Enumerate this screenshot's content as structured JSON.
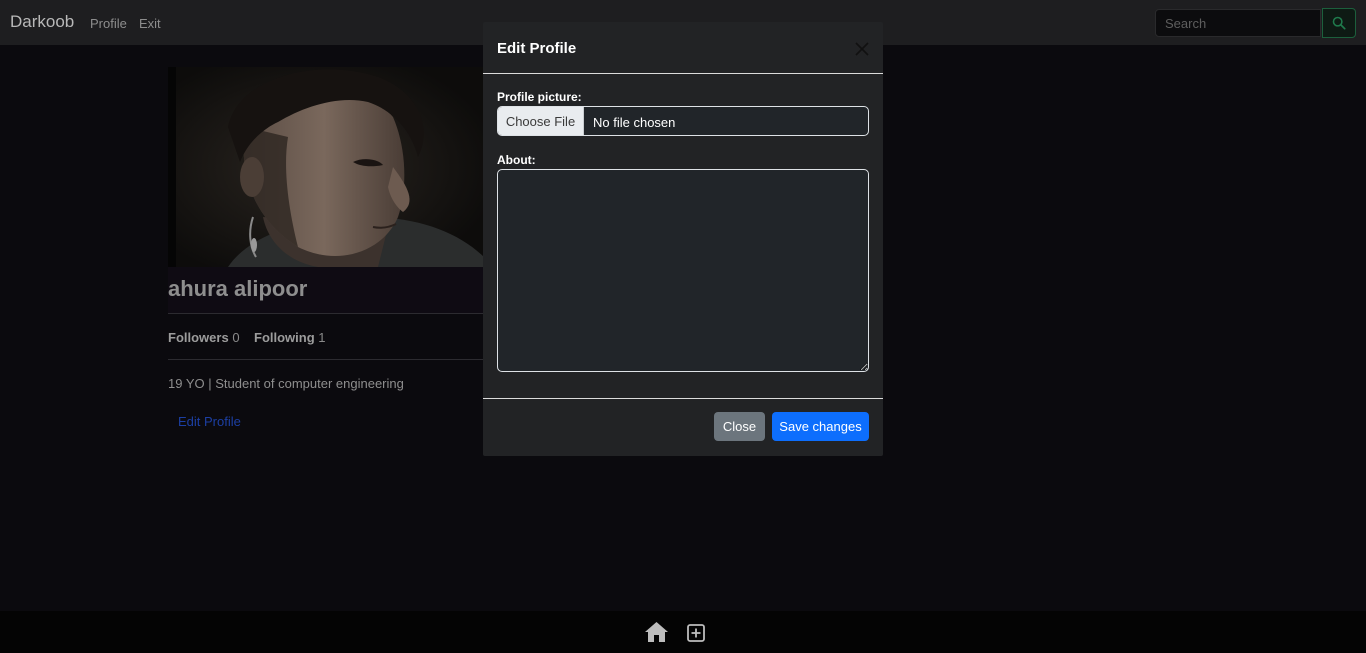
{
  "navbar": {
    "brand": "Darkoob",
    "links": [
      "Profile",
      "Exit"
    ],
    "search_placeholder": "Search"
  },
  "profile": {
    "name": "ahura alipoor",
    "followers_label": "Followers",
    "followers_count": "0",
    "following_label": "Following",
    "following_count": "1",
    "bio": "19 YO | Student of computer engineering",
    "edit_link": "Edit Profile"
  },
  "modal": {
    "title": "Edit Profile",
    "picture_label": "Profile picture:",
    "choose_file_label": "Choose File",
    "file_status": "No file chosen",
    "about_label": "About:",
    "about_value": "",
    "close_label": "Close",
    "save_label": "Save changes"
  },
  "bottombar": {
    "icons": [
      "home-icon",
      "plus-square-icon"
    ]
  },
  "colors": {
    "page_bg": "#0b0a0e",
    "navbar_bg": "#1e1e20",
    "modal_bg": "#222325",
    "primary": "#0d6efd",
    "secondary": "#6c757d",
    "search_accent": "#1c5f3c"
  }
}
